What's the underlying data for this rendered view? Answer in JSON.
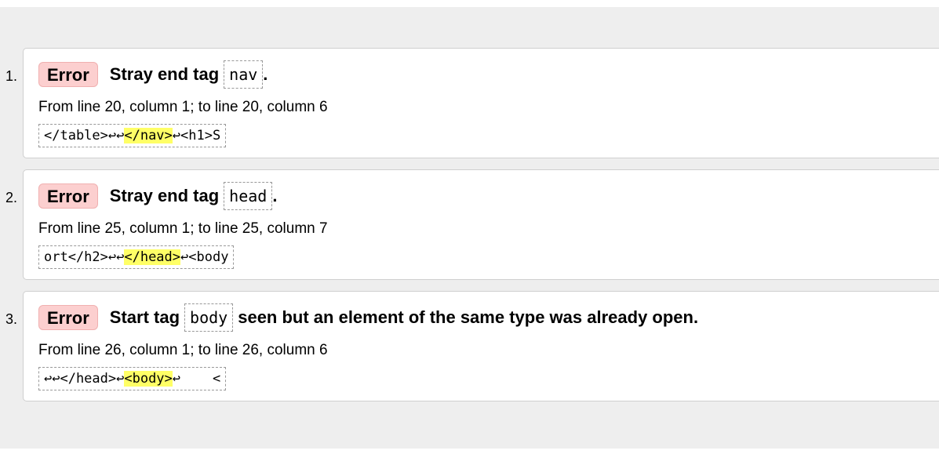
{
  "messages": [
    {
      "number": "1.",
      "type": "Error",
      "message_prefix": "Stray end tag",
      "tag": "nav",
      "message_suffix": ".",
      "location": "From line 20, column 1; to line 20, column 6",
      "extract": {
        "before": "</table>↩↩",
        "highlight": "</nav>",
        "after": "↩<h1>S"
      }
    },
    {
      "number": "2.",
      "type": "Error",
      "message_prefix": "Stray end tag",
      "tag": "head",
      "message_suffix": ".",
      "location": "From line 25, column 1; to line 25, column 7",
      "extract": {
        "before": "ort</h2>↩↩",
        "highlight": "</head>",
        "after": "↩<body"
      }
    },
    {
      "number": "3.",
      "type": "Error",
      "message_prefix": "Start tag",
      "tag": "body",
      "message_suffix": "seen but an element of the same type was already open.",
      "location": "From line 26, column 1; to line 26, column 6",
      "extract": {
        "before": "↩↩</head>↩",
        "highlight": "<body>",
        "after": "↩    <"
      }
    }
  ],
  "colors": {
    "error_badge_bg": "#fccfcf",
    "highlight": "#ffff66",
    "panel_bg": "#eeeeee"
  }
}
